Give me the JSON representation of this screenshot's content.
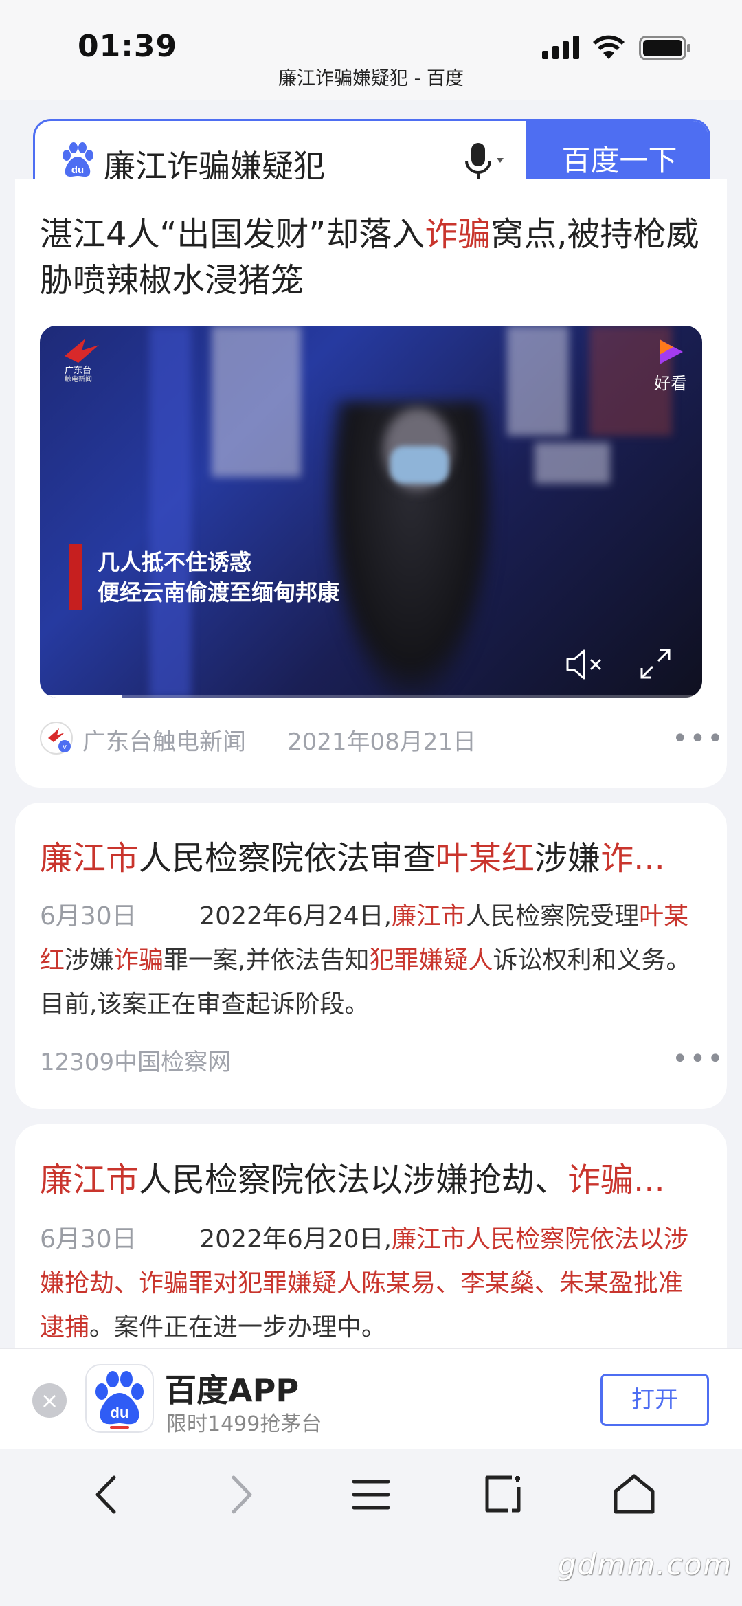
{
  "status": {
    "time": "01:39",
    "page_title": "廉江诈骗嫌疑犯 - 百度"
  },
  "search": {
    "query": "廉江诈骗嫌疑犯",
    "button_label": "百度一下"
  },
  "results": [
    {
      "title_parts": [
        "湛江4人“出国发财”却落入",
        "诈骗",
        "窝点,被持枪威胁喷辣椒水浸猪笼"
      ],
      "video": {
        "caption_line1": "几人抵不住诱惑",
        "caption_line2": "便经云南偷渡至缅甸邦康",
        "channel_logo_text": "广东台",
        "channel_logo_sub": "触电新闻",
        "platform": "好看"
      },
      "source": "广东台触电新闻",
      "date": "2021年08月21日",
      "more": "•••"
    },
    {
      "title_parts": [
        "廉江市",
        "人民检察院依法审查",
        "叶某红",
        "涉嫌",
        "诈..."
      ],
      "date": "6月30日",
      "snippet_parts": [
        "2022年6月24日,",
        "廉江市",
        "人民检察院受理",
        "叶某红",
        "涉嫌",
        "诈骗",
        "罪一案,并依法告知",
        "犯罪嫌疑人",
        "诉讼权利和义务。目前,该案正在审查起诉阶段。"
      ],
      "source": "12309中国检察网",
      "more": "•••"
    },
    {
      "title_parts": [
        "廉江市",
        "人民检察院依法以涉嫌抢劫、",
        "诈骗..."
      ],
      "date": "6月30日",
      "snippet_parts": [
        "2022年6月20日,",
        "廉江市人民检察院依法以涉嫌抢劫、诈骗罪对犯罪嫌疑人陈某易、李某燊、朱某盈批准逮捕",
        "。案件正在进一步办理中。"
      ]
    }
  ],
  "app_banner": {
    "close": "×",
    "name": "百度APP",
    "subtitle": "限时1499抢茅台",
    "open_label": "打开",
    "icon_text": "du"
  },
  "watermark": "gdmm.com",
  "colors": {
    "accent": "#4e6ef2",
    "highlight": "#c9352d",
    "meta": "#a0a3ab"
  }
}
